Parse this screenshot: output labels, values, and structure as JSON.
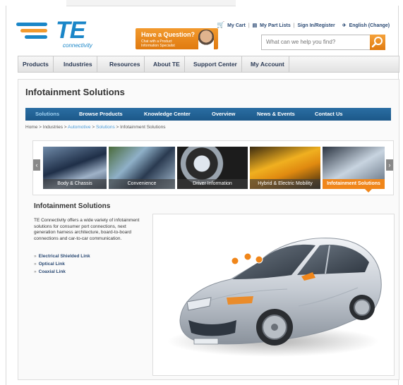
{
  "header": {
    "logo_text": "TE",
    "logo_subtext": "connectivity",
    "cart": "My Cart",
    "part_lists": "My Part Lists",
    "sign_in": "Sign In/Register",
    "language": "English (Change)",
    "promo_title": "Have a Question?",
    "promo_sub": "Chat with a Product Information Specialist",
    "search_placeholder": "What can we help you find?"
  },
  "main_nav": [
    "Products",
    "Industries",
    "Resources",
    "About TE",
    "Support Center",
    "My Account"
  ],
  "page_title": "Infotainment Solutions",
  "sub_nav": [
    "Solutions",
    "Browse Products",
    "Knowledge Center",
    "Overview",
    "News & Events",
    "Contact Us"
  ],
  "breadcrumb": {
    "home": "Home",
    "industries": "Industries",
    "automotive": "Automotive",
    "solutions": "Solutions",
    "current": "Infotainment Solutions",
    "sep": ">"
  },
  "carousel": [
    {
      "label": "Body & Chassis",
      "active": false
    },
    {
      "label": "Convenience",
      "active": false
    },
    {
      "label": "Driver Information",
      "active": false
    },
    {
      "label": "Hybrid & Electric Mobility",
      "active": false
    },
    {
      "label": "Infotainment Solutions",
      "active": true
    }
  ],
  "section": {
    "title": "Infotainment Solutions",
    "description": "TE Connectivity offers a wide variety of infotainment solutions for consumer port connections, next generation harness architecture, board-to-board connections and car-to-car communication.",
    "links": [
      "Electrical Shielded Link",
      "Optical Link",
      "Coaxial Link"
    ]
  },
  "colors": {
    "accent_blue": "#1a86c8",
    "nav_blue": "#1c5889",
    "orange": "#f0861a"
  }
}
